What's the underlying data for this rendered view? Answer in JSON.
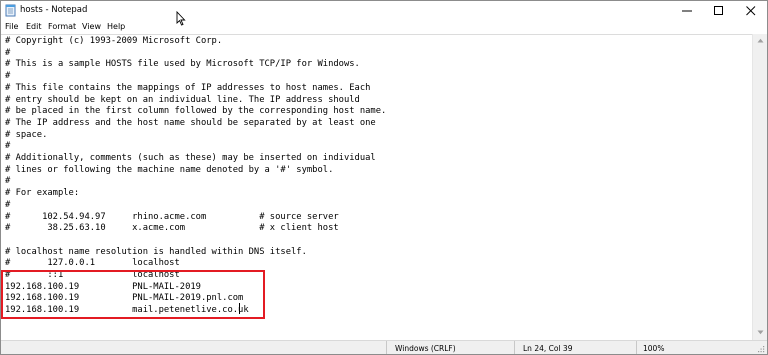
{
  "window": {
    "title": "hosts - Notepad",
    "app_icon": "notepad-icon",
    "controls": [
      "minimize-icon",
      "maximize-icon",
      "close-icon"
    ]
  },
  "menu": {
    "file": "File",
    "edit": "Edit",
    "format": "Format",
    "view": "View",
    "help": "Help"
  },
  "editor": {
    "lines": [
      "# Copyright (c) 1993-2009 Microsoft Corp.",
      "#",
      "# This is a sample HOSTS file used by Microsoft TCP/IP for Windows.",
      "#",
      "# This file contains the mappings of IP addresses to host names. Each",
      "# entry should be kept on an individual line. The IP address should",
      "# be placed in the first column followed by the corresponding host name.",
      "# The IP address and the host name should be separated by at least one",
      "# space.",
      "#",
      "# Additionally, comments (such as these) may be inserted on individual",
      "# lines or following the machine name denoted by a '#' symbol.",
      "#",
      "# For example:",
      "#",
      "#      102.54.94.97     rhino.acme.com          # source server",
      "#       38.25.63.10     x.acme.com              # x client host",
      "",
      "# localhost name resolution is handled within DNS itself.",
      "#       127.0.0.1       localhost",
      "#       ::1             localhost",
      "192.168.100.19          PNL-MAIL-2019",
      "192.168.100.19          PNL-MAIL-2019.pnl.com",
      "192.168.100.19          mail.petenetlive.co.uk"
    ],
    "highlight_color": "#e31b23"
  },
  "status": {
    "line_endings": "Windows (CRLF)",
    "position": "Ln 24, Col 39",
    "zoom": "100%"
  }
}
